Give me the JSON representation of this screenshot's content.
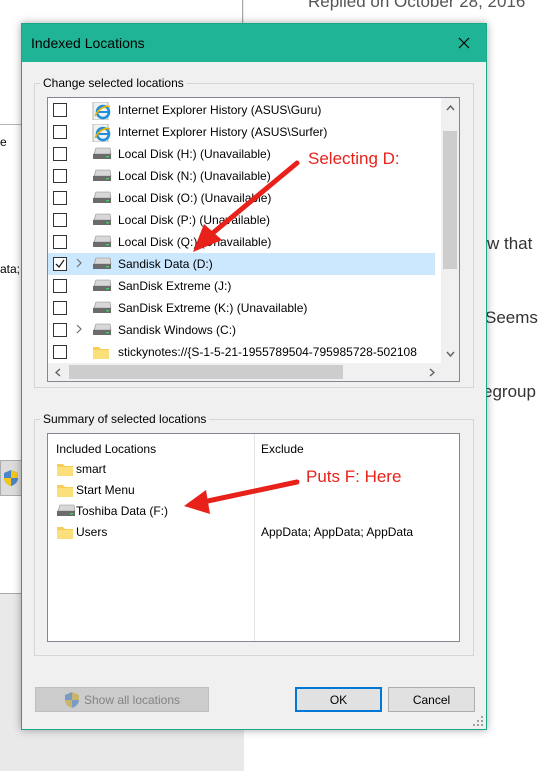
{
  "background": {
    "left_fragments": [
      "e",
      "ata;"
    ],
    "right_top": "Replied on October 28, 2016",
    "right_fragments": [
      "w that",
      "Seems",
      "egroup"
    ]
  },
  "dialog": {
    "title": "Indexed Locations",
    "close_glyph": "✕",
    "change_group_label": "Change selected locations",
    "tree_items": [
      {
        "label": "Internet Explorer History (ASUS\\Guru)",
        "icon": "ie-icon",
        "checked": false,
        "expandable": false
      },
      {
        "label": "Internet Explorer History (ASUS\\Surfer)",
        "icon": "ie-icon",
        "checked": false,
        "expandable": false
      },
      {
        "label": "Local Disk (H:) (Unavailable)",
        "icon": "drive-icon",
        "checked": false,
        "expandable": false
      },
      {
        "label": "Local Disk (N:) (Unavailable)",
        "icon": "drive-icon",
        "checked": false,
        "expandable": false
      },
      {
        "label": "Local Disk (O:) (Unavailable)",
        "icon": "drive-icon",
        "checked": false,
        "expandable": false
      },
      {
        "label": "Local Disk (P:) (Unavailable)",
        "icon": "drive-icon",
        "checked": false,
        "expandable": false
      },
      {
        "label": "Local Disk (Q:) (Unavailable)",
        "icon": "drive-icon",
        "checked": false,
        "expandable": false
      },
      {
        "label": "Sandisk Data (D:)",
        "icon": "drive-icon",
        "checked": true,
        "expandable": true,
        "selected": true
      },
      {
        "label": "SanDisk Extreme (J:)",
        "icon": "drive-icon",
        "checked": false,
        "expandable": false
      },
      {
        "label": "SanDisk Extreme (K:) (Unavailable)",
        "icon": "drive-icon",
        "checked": false,
        "expandable": false
      },
      {
        "label": "Sandisk Windows (C:)",
        "icon": "drive-icon",
        "checked": false,
        "expandable": true
      },
      {
        "label": "stickynotes://{S-1-5-21-1955789504-795985728-502108",
        "icon": "folder-icon",
        "checked": false,
        "expandable": false
      }
    ],
    "summary_group_label": "Summary of selected locations",
    "summary_headers": {
      "included": "Included Locations",
      "exclude": "Exclude"
    },
    "summary_rows": [
      {
        "name": "smart",
        "icon": "folder-icon",
        "exclude": ""
      },
      {
        "name": "Start Menu",
        "icon": "folder-icon",
        "exclude": ""
      },
      {
        "name": "Toshiba Data (F:)",
        "icon": "drive-icon",
        "exclude": ""
      },
      {
        "name": "Users",
        "icon": "folder-icon",
        "exclude": "AppData; AppData; AppData"
      }
    ],
    "show_all_label": "Show all locations",
    "ok_label": "OK",
    "cancel_label": "Cancel"
  },
  "annotations": {
    "selecting": "Selecting D:",
    "puts": "Puts F: Here",
    "color": "#e8221b"
  },
  "colors": {
    "titlebar": "#1fb496",
    "selection": "#cce8ff",
    "focus": "#0078d7"
  }
}
